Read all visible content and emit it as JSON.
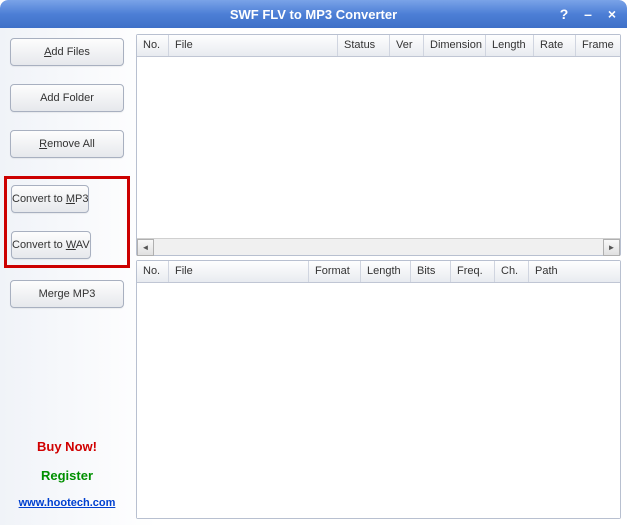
{
  "titlebar": {
    "title": "SWF FLV to MP3 Converter",
    "help": "?",
    "minimize": "–",
    "close": "×"
  },
  "sidebar": {
    "add_files": "Add Files",
    "add_files_ul": "A",
    "add_folder": "Add Folder",
    "remove_all": "Remove All",
    "remove_all_ul": "R",
    "convert_mp3_pre": "Convert to ",
    "convert_mp3_ul": "M",
    "convert_mp3_post": "P3",
    "convert_wav_pre": "Convert to ",
    "convert_wav_ul": "W",
    "convert_wav_post": "AV",
    "merge_mp3": "Merge MP3",
    "buy_now": "Buy Now!",
    "register": "Register",
    "website": "www.hootech.com"
  },
  "top_columns": {
    "no": "No.",
    "file": "File",
    "status": "Status",
    "ver": "Ver",
    "dimension": "Dimension",
    "length": "Length",
    "rate": "Rate",
    "frame": "Frame"
  },
  "bottom_columns": {
    "no": "No.",
    "file": "File",
    "format": "Format",
    "length": "Length",
    "bits": "Bits",
    "freq": "Freq.",
    "ch": "Ch.",
    "path": "Path"
  }
}
